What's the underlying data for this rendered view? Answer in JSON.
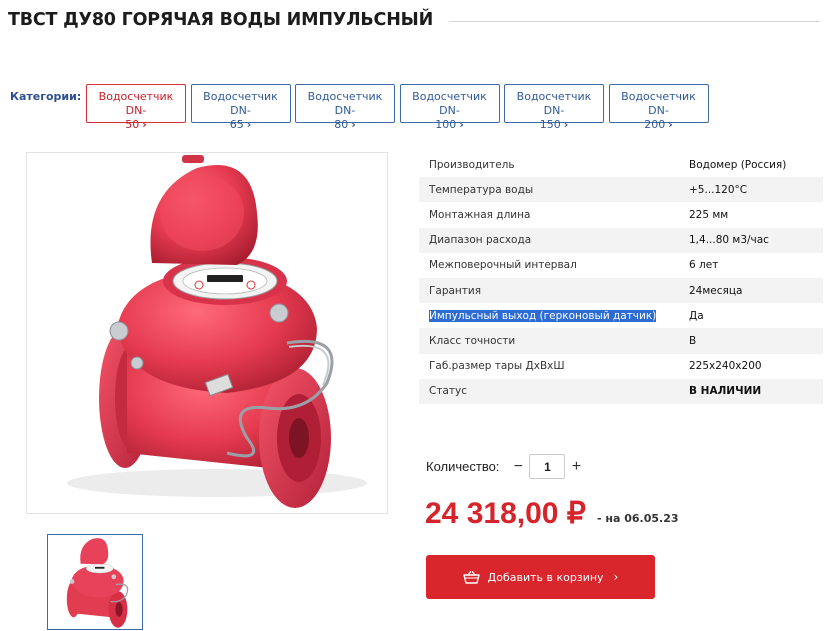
{
  "page": {
    "title": "ТВСТ ДУ80 ГОРЯЧАЯ ВОДЫ ИМПУЛЬСНЫЙ"
  },
  "categories": {
    "label": "Категории:",
    "items": [
      {
        "line1": "Водосчетчик DN-",
        "line2": "50",
        "active": true
      },
      {
        "line1": "Водосчетчик DN-",
        "line2": "65",
        "active": false
      },
      {
        "line1": "Водосчетчик DN-",
        "line2": "80",
        "active": false
      },
      {
        "line1": "Водосчетчик DN-",
        "line2": "100",
        "active": false
      },
      {
        "line1": "Водосчетчик DN-",
        "line2": "150",
        "active": false
      },
      {
        "line1": "Водосчетчик DN-",
        "line2": "200",
        "active": false
      }
    ]
  },
  "specs": [
    {
      "key": "Производитель",
      "value": "Водомер (Россия)"
    },
    {
      "key": "Температура воды",
      "value": "+5...120°C"
    },
    {
      "key": "Монтажная длина",
      "value": "225 мм"
    },
    {
      "key": "Диапазон расхода",
      "value": "1,4...80 м3/час"
    },
    {
      "key": "Межповерочный интервал",
      "value": "6 лет"
    },
    {
      "key": "Гарантия",
      "value": "24месяца"
    },
    {
      "key": "Импульсный выход (герконовый датчик)",
      "value": "Да",
      "selected": true
    },
    {
      "key": "Класс точности",
      "value": "В"
    },
    {
      "key": "Габ.размер тары ДхВхШ",
      "value": "225x240x200"
    },
    {
      "key": "Статус",
      "value": "В НАЛИЧИИ"
    }
  ],
  "quantity": {
    "label": "Количество:",
    "value": "1",
    "minus": "−",
    "plus": "+"
  },
  "price": {
    "amount": "24 318,00 ₽",
    "date_note": "- на 06.05.23"
  },
  "cart": {
    "label": "Добавить в корзину",
    "chevron": "›"
  },
  "colors": {
    "accent_red": "#d9262d",
    "link_blue": "#2f5a98",
    "selection_blue": "#2d6dd3"
  },
  "icons": [
    "basket-icon",
    "chevron-right-icon"
  ]
}
